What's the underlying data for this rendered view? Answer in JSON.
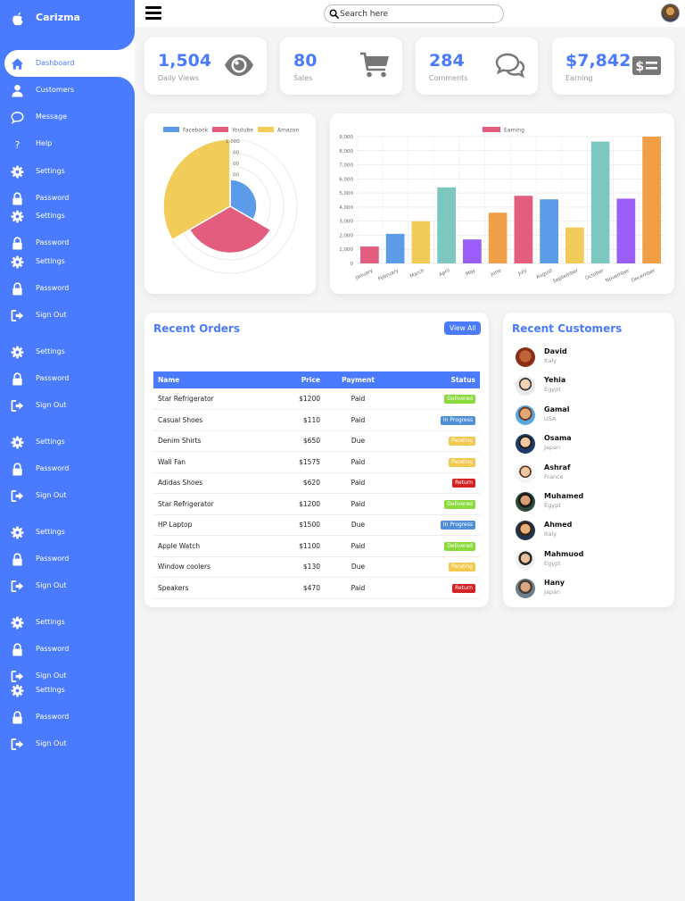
{
  "brand": {
    "name": "Carizma",
    "logo_icon": "apple-icon"
  },
  "sidebar": {
    "items": [
      {
        "label": "Dashboard",
        "icon": "home-icon",
        "active": true
      },
      {
        "label": "Customers",
        "icon": "user-icon"
      },
      {
        "label": "Message",
        "icon": "chat-icon"
      },
      {
        "label": "Help",
        "icon": "help-icon"
      },
      {
        "label": "Settings",
        "icon": "gear-icon"
      },
      {
        "label": "Password",
        "icon": "lock-icon"
      },
      {
        "label": "Settings",
        "icon": "gear-icon"
      },
      {
        "label": "Password",
        "icon": "lock-icon"
      },
      {
        "label": "Settings",
        "icon": "gear-icon"
      },
      {
        "label": "Password",
        "icon": "lock-icon"
      },
      {
        "label": "Sign Out",
        "icon": "sign-out-icon"
      },
      {
        "label": "Settings",
        "icon": "gear-icon"
      },
      {
        "label": "Password",
        "icon": "lock-icon"
      },
      {
        "label": "Sign Out",
        "icon": "sign-out-icon"
      },
      {
        "label": "Settings",
        "icon": "gear-icon"
      },
      {
        "label": "Password",
        "icon": "lock-icon"
      },
      {
        "label": "Sign Out",
        "icon": "sign-out-icon"
      },
      {
        "label": "Settings",
        "icon": "gear-icon"
      },
      {
        "label": "Password",
        "icon": "lock-icon"
      },
      {
        "label": "Sign Out",
        "icon": "sign-out-icon"
      },
      {
        "label": "Settings",
        "icon": "gear-icon"
      },
      {
        "label": "Password",
        "icon": "lock-icon"
      },
      {
        "label": "Sign Out",
        "icon": "sign-out-icon"
      },
      {
        "label": "Settings",
        "icon": "gear-icon"
      },
      {
        "label": "Password",
        "icon": "lock-icon"
      },
      {
        "label": "Sign Out",
        "icon": "sign-out-icon"
      }
    ]
  },
  "topbar": {
    "search_placeholder": "Search here"
  },
  "stats": [
    {
      "value": "1,504",
      "caption": "Daily Views",
      "icon": "eye-icon"
    },
    {
      "value": "80",
      "caption": "Sales",
      "icon": "cart-icon"
    },
    {
      "value": "284",
      "caption": "Comments",
      "icon": "comments-icon"
    },
    {
      "value": "$7,842",
      "caption": "Earning",
      "icon": "money-icon"
    }
  ],
  "colors": {
    "accent": "#4a7bff",
    "facebook": "#5b9be8",
    "youtube": "#e35d7f",
    "amazon": "#f2cc59"
  },
  "chart_data": [
    {
      "type": "polar-area",
      "categories": [
        "Facebook",
        "Youtube",
        "Amazon"
      ],
      "values": [
        400,
        700,
        1000
      ],
      "colors": [
        "#5b9be8",
        "#e35d7f",
        "#f2cc59"
      ],
      "radial_ticks": [
        "1,000",
        "00",
        "00",
        "00"
      ],
      "legend_position": "top"
    },
    {
      "type": "bar",
      "series": [
        {
          "name": "Earning",
          "color": "#e35d7f"
        }
      ],
      "categories": [
        "January",
        "February",
        "March",
        "April",
        "May",
        "June",
        "July",
        "August",
        "September",
        "October",
        "November",
        "December"
      ],
      "values": [
        1200,
        2100,
        3000,
        5400,
        1700,
        3600,
        4800,
        4550,
        2550,
        8650,
        4600,
        9000
      ],
      "bar_colors": [
        "#e35d7f",
        "#5b9be8",
        "#f2cc59",
        "#7cc7c0",
        "#9b5df7",
        "#f09f47",
        "#e35d7f",
        "#5b9be8",
        "#f2cc59",
        "#7cc7c0",
        "#9b5df7",
        "#f09f47"
      ],
      "yticks": [
        "0",
        "1,000",
        "2,000",
        "3,000",
        "4,000",
        "5,000",
        "6,000",
        "7,000",
        "8,000",
        "9,000"
      ],
      "ylim": [
        0,
        9000
      ],
      "grid": true,
      "legend_position": "top"
    }
  ],
  "orders": {
    "title": "Recent Orders",
    "view_all": "View All",
    "columns": [
      "Name",
      "Price",
      "Payment",
      "Status"
    ],
    "rows": [
      {
        "name": "Star Refrigerator",
        "price": "$1200",
        "payment": "Paid",
        "status": "Delivered",
        "color": "#8cd93b"
      },
      {
        "name": "Casual Shoes",
        "price": "$110",
        "payment": "Paid",
        "status": "In Progress",
        "color": "#4e8fd8"
      },
      {
        "name": "Denim Shirts",
        "price": "$650",
        "payment": "Due",
        "status": "Pending",
        "color": "#f2c94c"
      },
      {
        "name": "Wall Fan",
        "price": "$1575",
        "payment": "Paid",
        "status": "Pending",
        "color": "#f2c94c"
      },
      {
        "name": "Adidas Shoes",
        "price": "$620",
        "payment": "Paid",
        "status": "Return",
        "color": "#d42121"
      },
      {
        "name": "Star Refrigerator",
        "price": "$1200",
        "payment": "Paid",
        "status": "Delivered",
        "color": "#8cd93b"
      },
      {
        "name": "HP Laptop",
        "price": "$1500",
        "payment": "Due",
        "status": "In Progress",
        "color": "#4e8fd8"
      },
      {
        "name": "Apple Watch",
        "price": "$1100",
        "payment": "Paid",
        "status": "Delivered",
        "color": "#8cd93b"
      },
      {
        "name": "Window coolers",
        "price": "$130",
        "payment": "Due",
        "status": "Pending",
        "color": "#f2c94c"
      },
      {
        "name": "Speakers",
        "price": "$470",
        "payment": "Paid",
        "status": "Return",
        "color": "#d42121"
      }
    ]
  },
  "customers": {
    "title": "Recent Customers",
    "items": [
      {
        "name": "David",
        "country": "Italy"
      },
      {
        "name": "Yehia",
        "country": "Egypt"
      },
      {
        "name": "Gamal",
        "country": "USA"
      },
      {
        "name": "Osama",
        "country": "Japan"
      },
      {
        "name": "Ashraf",
        "country": "France"
      },
      {
        "name": "Muhamed",
        "country": "Egypt"
      },
      {
        "name": "Ahmed",
        "country": "Italy"
      },
      {
        "name": "Mahmuod",
        "country": "Egypt"
      },
      {
        "name": "Hany",
        "country": "Japan"
      }
    ]
  }
}
